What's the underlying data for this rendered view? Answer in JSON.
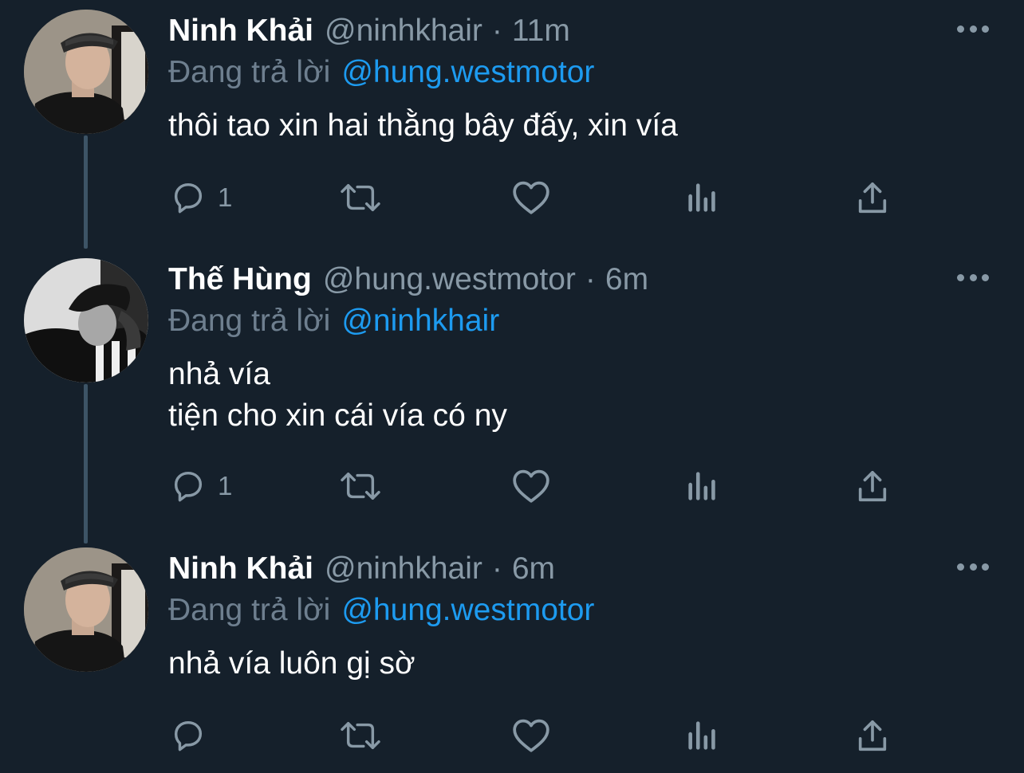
{
  "tweets": [
    {
      "author_name": "Ninh Khải",
      "handle": "@ninhkhair",
      "separator": "·",
      "time": "11m",
      "reply_prefix": "Đang trả lời",
      "reply_to": "@hung.westmotor",
      "text_lines": [
        "thôi tao xin hai thằng bây đấy, xin vía"
      ],
      "reply_count": "1"
    },
    {
      "author_name": "Thế Hùng",
      "handle": "@hung.westmotor",
      "separator": "·",
      "time": "6m",
      "reply_prefix": "Đang trả lời",
      "reply_to": "@ninhkhair",
      "text_lines": [
        "nhả vía",
        "tiện cho xin cái vía có ny"
      ],
      "reply_count": "1"
    },
    {
      "author_name": "Ninh Khải",
      "handle": "@ninhkhair",
      "separator": "·",
      "time": "6m",
      "reply_prefix": "Đang trả lời",
      "reply_to": "@hung.westmotor",
      "text_lines": [
        "nhả vía luôn gị sờ"
      ],
      "reply_count": ""
    }
  ],
  "icons": {
    "reply": "reply-icon",
    "retweet": "retweet-icon",
    "like": "heart-icon",
    "analytics": "analytics-icon",
    "share": "share-icon",
    "more": "more-options-icon"
  },
  "colors": {
    "background": "#15202b",
    "primary_text": "#ffffff",
    "secondary_text": "#8899a6",
    "link": "#1d9bf0",
    "thread_line": "#3d5466"
  }
}
